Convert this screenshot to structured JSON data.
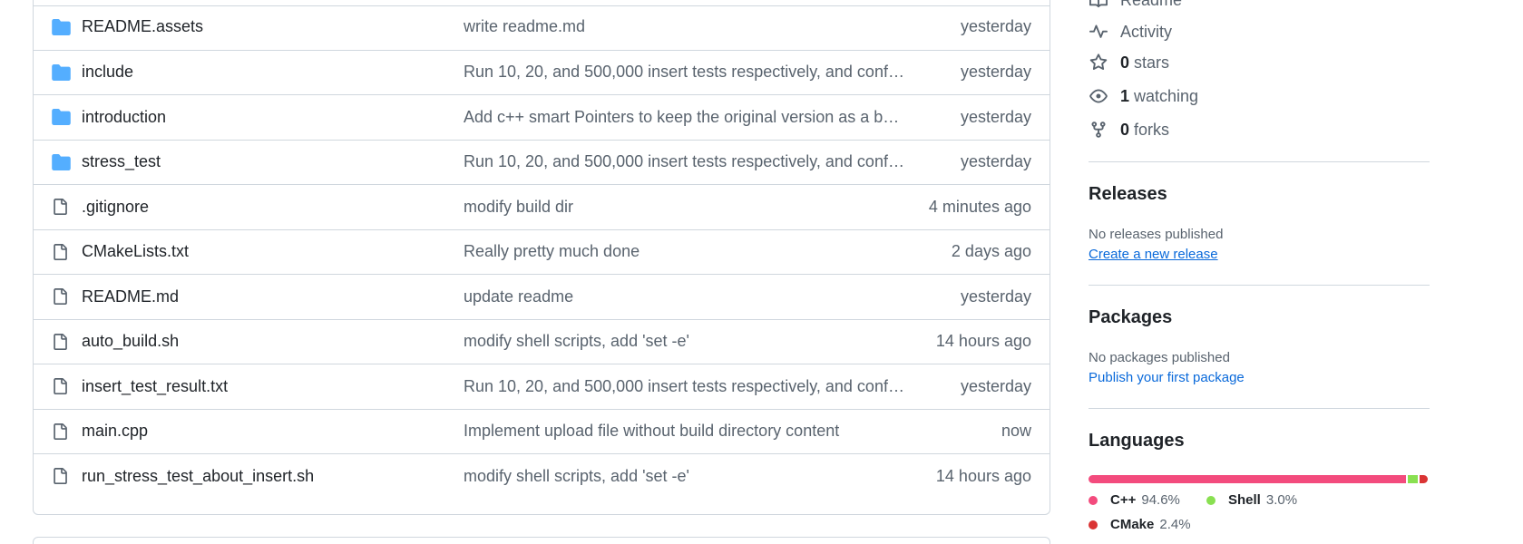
{
  "files": [
    {
      "type": "folder",
      "name": "README.assets",
      "message": "write readme.md",
      "time": "yesterday"
    },
    {
      "type": "folder",
      "name": "include",
      "message": "Run 10, 20, and 500,000 insert tests respectively, and config...",
      "time": "yesterday"
    },
    {
      "type": "folder",
      "name": "introduction",
      "message": "Add c++ smart Pointers to keep the original version as a bac...",
      "time": "yesterday"
    },
    {
      "type": "folder",
      "name": "stress_test",
      "message": "Run 10, 20, and 500,000 insert tests respectively, and config...",
      "time": "yesterday"
    },
    {
      "type": "file",
      "name": ".gitignore",
      "message": "modify build dir",
      "time": "4 minutes ago"
    },
    {
      "type": "file",
      "name": "CMakeLists.txt",
      "message": "Really pretty much done",
      "time": "2 days ago"
    },
    {
      "type": "file",
      "name": "README.md",
      "message": "update readme",
      "time": "yesterday"
    },
    {
      "type": "file",
      "name": "auto_build.sh",
      "message": "modify shell scripts, add 'set -e'",
      "time": "14 hours ago"
    },
    {
      "type": "file",
      "name": "insert_test_result.txt",
      "message": "Run 10, 20, and 500,000 insert tests respectively, and config...",
      "time": "yesterday"
    },
    {
      "type": "file",
      "name": "main.cpp",
      "message": "Implement upload file without build directory content",
      "time": "now"
    },
    {
      "type": "file",
      "name": "run_stress_test_about_insert.sh",
      "message": "modify shell scripts, add 'set -e'",
      "time": "14 hours ago"
    }
  ],
  "about": {
    "readme_label": "Readme",
    "activity_label": "Activity",
    "stars_count": "0",
    "stars_label": "stars",
    "watching_count": "1",
    "watching_label": "watching",
    "forks_count": "0",
    "forks_label": "forks"
  },
  "releases": {
    "heading": "Releases",
    "empty_text": "No releases published",
    "create_link": "Create a new release"
  },
  "packages": {
    "heading": "Packages",
    "empty_text": "No packages published",
    "publish_link": "Publish your first package"
  },
  "languages": {
    "heading": "Languages",
    "items": [
      {
        "name": "C++",
        "percent": "94.6%",
        "value": 94.6,
        "color": "#f34b7d"
      },
      {
        "name": "Shell",
        "percent": "3.0%",
        "value": 3.0,
        "color": "#89e051"
      },
      {
        "name": "CMake",
        "percent": "2.4%",
        "value": 2.4,
        "color": "#da3434"
      }
    ]
  },
  "colors": {
    "folder": "#54aeff",
    "file_icon": "#59636e",
    "link": "#0969da",
    "border": "#d0d7de"
  }
}
